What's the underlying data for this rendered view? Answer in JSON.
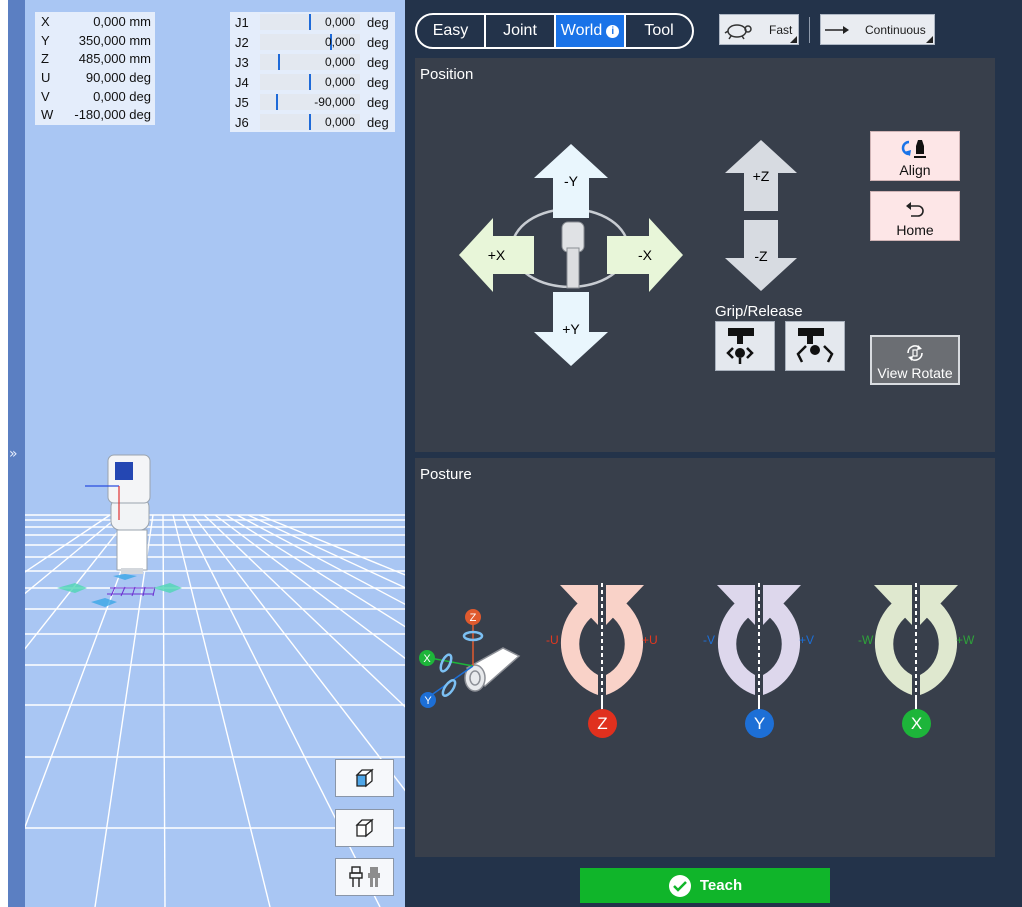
{
  "world_coords": [
    {
      "label": "X",
      "value": "0,000 mm"
    },
    {
      "label": "Y",
      "value": "350,000 mm"
    },
    {
      "label": "Z",
      "value": "485,000 mm"
    },
    {
      "label": "U",
      "value": "90,000 deg"
    },
    {
      "label": "V",
      "value": "0,000 deg"
    },
    {
      "label": "W",
      "value": "-180,000 deg"
    }
  ],
  "joints": [
    {
      "label": "J1",
      "value": "0,000",
      "unit": "deg"
    },
    {
      "label": "J2",
      "value": "0,000",
      "unit": "deg"
    },
    {
      "label": "J3",
      "value": "0,000",
      "unit": "deg"
    },
    {
      "label": "J4",
      "value": "0,000",
      "unit": "deg"
    },
    {
      "label": "J5",
      "value": "-90,000",
      "unit": "deg"
    },
    {
      "label": "J6",
      "value": "0,000",
      "unit": "deg"
    }
  ],
  "collapse_glyph": "»",
  "mode_tabs": {
    "easy": "Easy",
    "joint": "Joint",
    "world": "World",
    "tool": "Tool",
    "info_glyph": "i"
  },
  "speed": {
    "label": "Fast",
    "icon": "turtle-icon"
  },
  "step_mode": {
    "label": "Continuous",
    "icon": "arrow-right-icon"
  },
  "position": {
    "title": "Position",
    "minus_y": "-Y",
    "plus_y": "+Y",
    "plus_x": "+X",
    "minus_x": "-X",
    "plus_z": "+Z",
    "minus_z": "-Z",
    "align": "Align",
    "home": "Home",
    "grip_release": "Grip/Release",
    "view_rotate": "View Rotate"
  },
  "posture": {
    "title": "Posture",
    "u_minus": "-U",
    "u_plus": "+U",
    "u_axis": "Z",
    "v_minus": "-V",
    "v_plus": "+V",
    "v_axis": "Y",
    "w_minus": "-W",
    "w_plus": "+W",
    "w_axis": "X",
    "diagram_z": "Z",
    "diagram_x": "X",
    "diagram_y": "Y"
  },
  "teach": "Teach",
  "colors": {
    "panel_bg": "#23334a",
    "section_bg": "#383f4b",
    "active_tab": "#1a73e8",
    "xy_arrow": "#e9f6fd",
    "x_arrow": "#e8f6d9",
    "z_arrow": "#d7dbe1",
    "u_ring": "#f9d2c8",
    "v_ring": "#ddd7ec",
    "w_ring": "#dfe8cf",
    "z_badge": "#e0301e",
    "y_badge": "#1d6fd6",
    "x_badge": "#1db53a",
    "teach": "#10b52a"
  }
}
